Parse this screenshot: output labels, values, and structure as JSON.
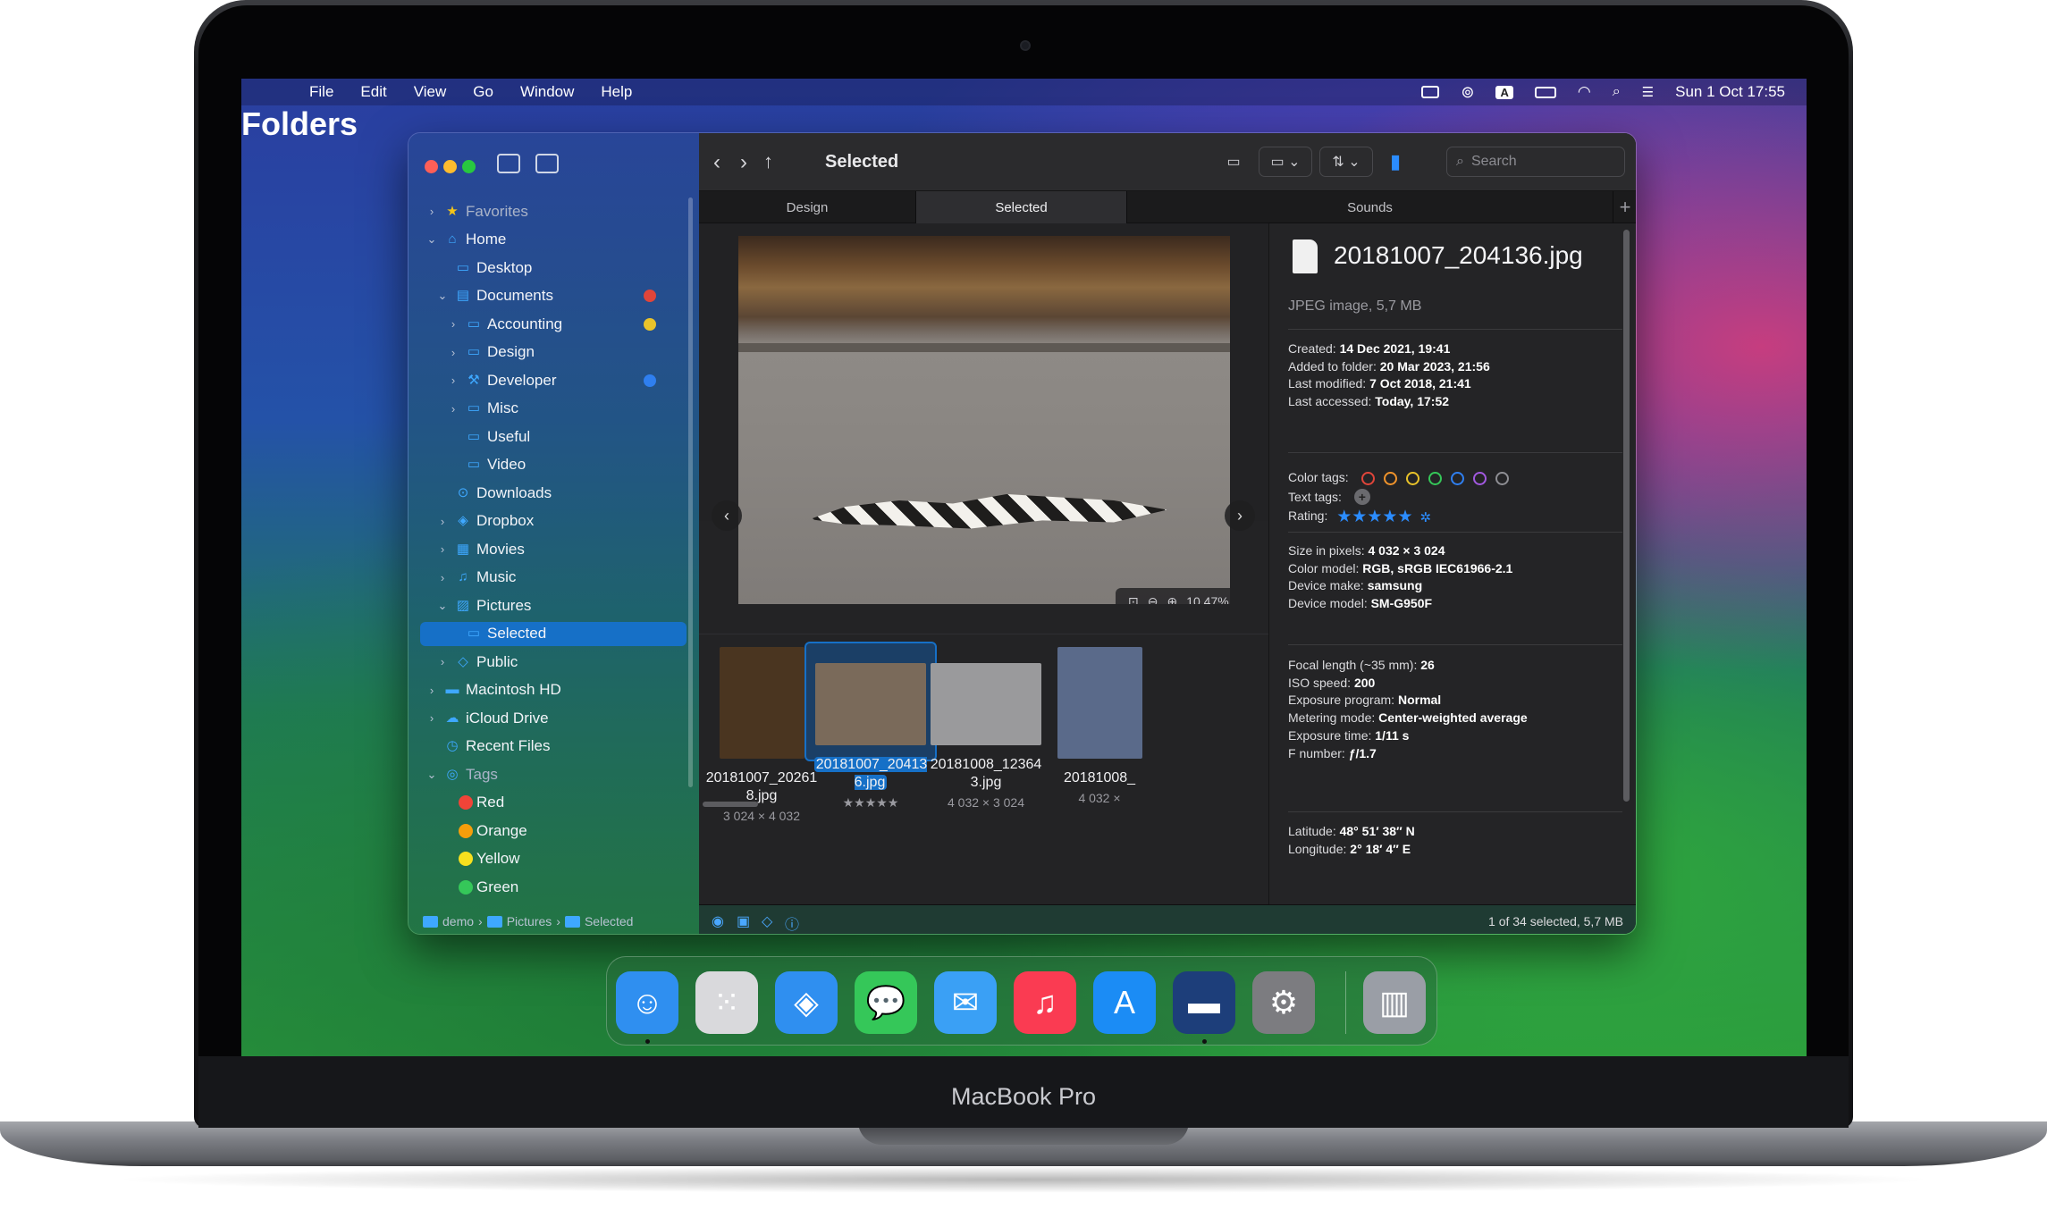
{
  "menubar": {
    "apple_icon": "apple-icon",
    "app_name": "Folders",
    "items": [
      "File",
      "Edit",
      "View",
      "Go",
      "Window",
      "Help"
    ],
    "status_icons": [
      "keyboard-icon",
      "sync-icon",
      "input-source-icon",
      "battery-icon",
      "wifi-icon",
      "search-icon",
      "control-center-icon"
    ],
    "input_source": "A",
    "clock": "Sun 1 Oct  17:55"
  },
  "sidebar": {
    "items": [
      {
        "label": "Favorites",
        "icon": "star-icon",
        "section": true
      },
      {
        "label": "Home",
        "icon": "home-icon"
      },
      {
        "label": "Desktop",
        "icon": "desktop-icon"
      },
      {
        "label": "Documents",
        "icon": "document-icon",
        "tag_color": "#e0453a"
      },
      {
        "label": "Accounting",
        "icon": "folder-icon",
        "tag_color": "#e9c32a"
      },
      {
        "label": "Design",
        "icon": "folder-icon"
      },
      {
        "label": "Developer",
        "icon": "hammer-icon",
        "tag_color": "#2f7ff0"
      },
      {
        "label": "Misc",
        "icon": "folder-icon"
      },
      {
        "label": "Useful",
        "icon": "folder-icon"
      },
      {
        "label": "Video",
        "icon": "folder-icon"
      },
      {
        "label": "Downloads",
        "icon": "download-icon"
      },
      {
        "label": "Dropbox",
        "icon": "dropbox-icon"
      },
      {
        "label": "Movies",
        "icon": "film-icon"
      },
      {
        "label": "Music",
        "icon": "music-icon"
      },
      {
        "label": "Pictures",
        "icon": "photo-icon"
      },
      {
        "label": "Selected",
        "icon": "folder-icon"
      },
      {
        "label": "Public",
        "icon": "public-icon"
      },
      {
        "label": "Macintosh HD",
        "icon": "disk-icon"
      },
      {
        "label": "iCloud Drive",
        "icon": "cloud-icon"
      },
      {
        "label": "Recent Files",
        "icon": "clock-icon"
      },
      {
        "label": "Tags",
        "icon": "tag-icon",
        "section": true
      },
      {
        "label": "Red",
        "color": "#f04438"
      },
      {
        "label": "Orange",
        "color": "#f59e0b"
      },
      {
        "label": "Yellow",
        "color": "#f7e01e"
      },
      {
        "label": "Green",
        "color": "#35c759"
      }
    ],
    "path": [
      "demo",
      "Pictures",
      "Selected"
    ],
    "path_separator": "›"
  },
  "toolbar": {
    "back_icon": "‹",
    "forward_icon": "›",
    "up_icon": "↑",
    "title": "Selected",
    "search_placeholder": "Search"
  },
  "tabs": [
    "Design",
    "Selected",
    "Sounds"
  ],
  "preview": {
    "zoom": "10.47%",
    "prev_icon": "‹",
    "next_icon": "›"
  },
  "thumbnails": [
    {
      "name": "20181007_202618.jpg",
      "sub": "3 024 × 4 032",
      "color": "#4a3520"
    },
    {
      "name": "20181007_204136.jpg",
      "sub": "★★★★★",
      "color": "#7a6a5a",
      "selected": true
    },
    {
      "name": "20181008_123643.jpg",
      "sub": "4 032 × 3 024",
      "color": "#9a9a9c"
    },
    {
      "name": "20181008_",
      "sub": "4 032 ×",
      "color": "#5a6a8a"
    }
  ],
  "inspector": {
    "filename": "20181007_204136.jpg",
    "filetype": "JPEG image, 5,7 MB",
    "dates": [
      {
        "k": "Created:",
        "v": "14 Dec 2021, 19:41"
      },
      {
        "k": "Added to folder:",
        "v": "20 Mar 2023, 21:56"
      },
      {
        "k": "Last modified:",
        "v": "7 Oct 2018, 21:41"
      },
      {
        "k": "Last accessed:",
        "v": "Today, 17:52"
      }
    ],
    "color_tags_label": "Color tags:",
    "color_tags": [
      "#e0453a",
      "#f0932b",
      "#e9c32a",
      "#35c759",
      "#2f7ff0",
      "#a259e0",
      "#8e8e93"
    ],
    "text_tags_label": "Text tags:",
    "rating_label": "Rating:",
    "rating": 5,
    "image_props": [
      {
        "k": "Size in pixels:",
        "v": "4 032 × 3 024"
      },
      {
        "k": "Color model:",
        "v": "RGB, sRGB IEC61966-2.1"
      },
      {
        "k": "Device make:",
        "v": "samsung"
      },
      {
        "k": "Device model:",
        "v": "SM-G950F"
      }
    ],
    "exif": [
      {
        "k": "Focal length (~35 mm):",
        "v": "26"
      },
      {
        "k": "ISO speed:",
        "v": "200"
      },
      {
        "k": "Exposure program:",
        "v": "Normal"
      },
      {
        "k": "Metering mode:",
        "v": "Center-weighted average"
      },
      {
        "k": "Exposure time:",
        "v": "1/11 s"
      },
      {
        "k": "F number:",
        "v": "ƒ/1.7"
      }
    ],
    "geo": [
      {
        "k": "Latitude:",
        "v": "48° 51′ 38″ N"
      },
      {
        "k": "Longitude:",
        "v": "2° 18′ 4″ E"
      }
    ]
  },
  "status": "1 of 34 selected, 5,7 MB",
  "dock": [
    {
      "name": "finder",
      "icon": "finder-icon",
      "color": "#2f8ff0",
      "running": true
    },
    {
      "name": "launchpad",
      "icon": "launchpad-icon",
      "color": "#d9d9dc"
    },
    {
      "name": "safari",
      "icon": "safari-icon",
      "color": "#2f8ff0"
    },
    {
      "name": "messages",
      "icon": "messages-icon",
      "color": "#35c759"
    },
    {
      "name": "mail",
      "icon": "mail-icon",
      "color": "#3aa0f5"
    },
    {
      "name": "music",
      "icon": "music-icon",
      "color": "#fa3b52"
    },
    {
      "name": "app-store",
      "icon": "app-store-icon",
      "color": "#1b8cf5"
    },
    {
      "name": "folders",
      "icon": "folder-icon",
      "color": "#1d3e7a",
      "running": true
    },
    {
      "name": "system-settings",
      "icon": "gear-icon",
      "color": "#7c7c80"
    },
    {
      "name": "trash",
      "icon": "trash-icon",
      "color": "#9a9ea6"
    }
  ],
  "device_label": "MacBook Pro"
}
